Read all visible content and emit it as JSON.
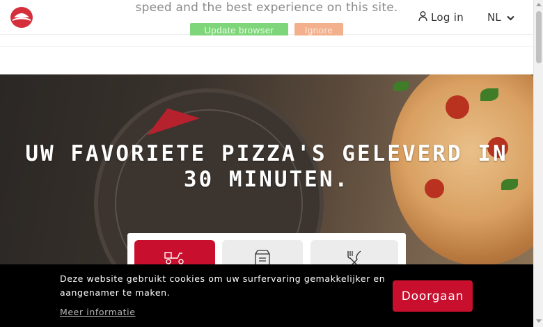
{
  "browser_banner": {
    "message": "speed and the best experience on this site.",
    "update_label": "Update browser",
    "ignore_label": "Ignore"
  },
  "header": {
    "login_label": "Log in",
    "language": "NL"
  },
  "hero": {
    "title_line1": "UW FAVORIETE PIZZA'S GELEVERD IN",
    "title_line2": "30 MINUTEN."
  },
  "cookie_bar": {
    "text": "Deze website gebruikt cookies om uw surfervaring gemakkelijker en aangenamer te maken.",
    "more_info_label": "Meer informatie",
    "accept_label": "Doorgaan"
  },
  "colors": {
    "brand_red": "#c8102e",
    "cookie_bg": "#000000",
    "update_green": "#7fd67a",
    "ignore_orange": "#f3b08c"
  },
  "icons": {
    "logo": "pizza-hut-logo",
    "login": "user-icon",
    "language": "chevron-down-icon",
    "delivery": "scooter-icon",
    "takeaway": "pizza-box-icon",
    "dinein": "fork-knife-icon"
  }
}
